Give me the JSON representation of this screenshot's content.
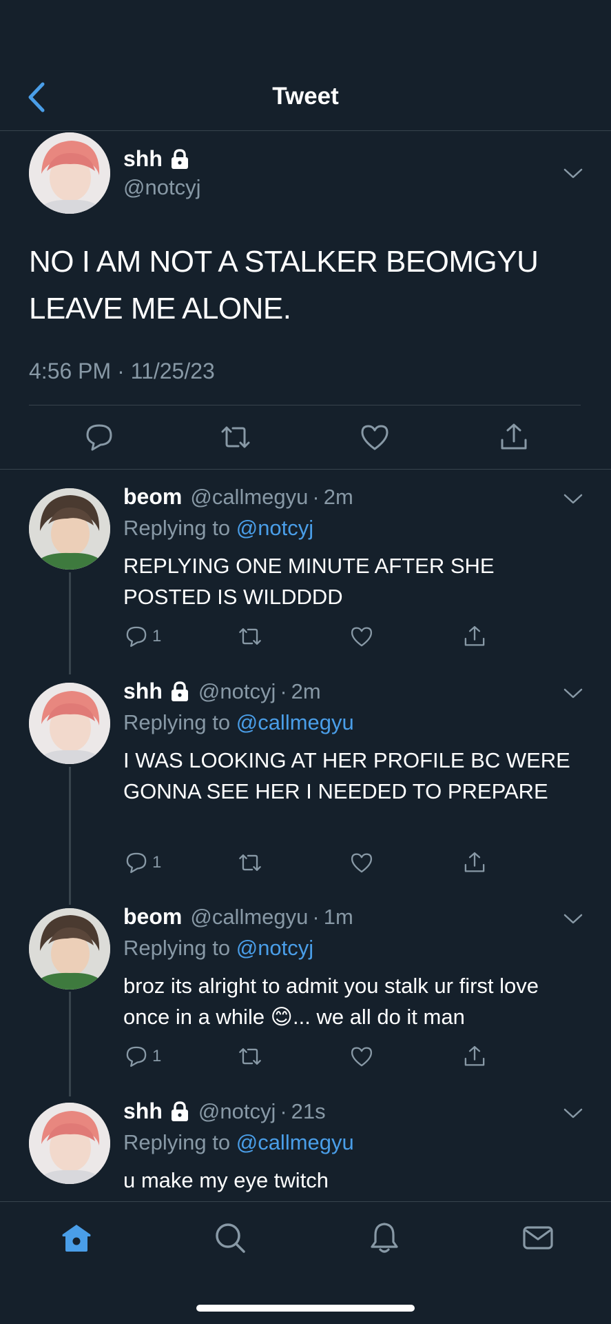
{
  "header": {
    "title": "Tweet",
    "back_icon": "chevron-left-icon"
  },
  "main_tweet": {
    "name": "shh",
    "handle": "@notcyj",
    "text": "NO I AM NOT A STALKER BEOMGYU LEAVE ME ALONE.",
    "timestamp": "4:56 PM · 11/25/23",
    "actions": [
      "reply-icon",
      "retweet-icon",
      "like-icon",
      "share-icon"
    ]
  },
  "replies": [
    {
      "name": "beom",
      "handle": "@callmegyu",
      "dot": "·",
      "time": "2m",
      "replying_prefix": "Replying to",
      "replying_to": "@notcyj",
      "text": "REPLYING ONE MINUTE AFTER SHE POSTED IS WILDDDD",
      "reply_count": "1",
      "locked": false
    },
    {
      "name": "shh",
      "handle": "@notcyj",
      "dot": "·",
      "time": "2m",
      "replying_prefix": "Replying to",
      "replying_to": "@callmegyu",
      "text": "I WAS LOOKING AT HER PROFILE BC WERE GONNA SEE HER I NEEDED TO PREPARE",
      "reply_count": "1",
      "locked": true
    },
    {
      "name": "beom",
      "handle": "@callmegyu",
      "dot": "·",
      "time": "1m",
      "replying_prefix": "Replying to",
      "replying_to": "@notcyj",
      "text": "broz its alright to admit you stalk ur first love once in a while 😊... we all do it man",
      "reply_count": "1",
      "locked": false
    },
    {
      "name": "shh",
      "handle": "@notcyj",
      "dot": "·",
      "time": "21s",
      "replying_prefix": "Replying to",
      "replying_to": "@callmegyu",
      "text": "u make my eye twitch",
      "reply_count": "",
      "locked": true
    }
  ],
  "tabbar": {
    "items": [
      "home-icon",
      "search-icon",
      "notifications-icon",
      "messages-icon"
    ],
    "active": "home-icon"
  },
  "colors": {
    "background": "#15202b",
    "accent": "#4a9ee8",
    "secondary_text": "#8899a6",
    "border": "#38444d"
  }
}
